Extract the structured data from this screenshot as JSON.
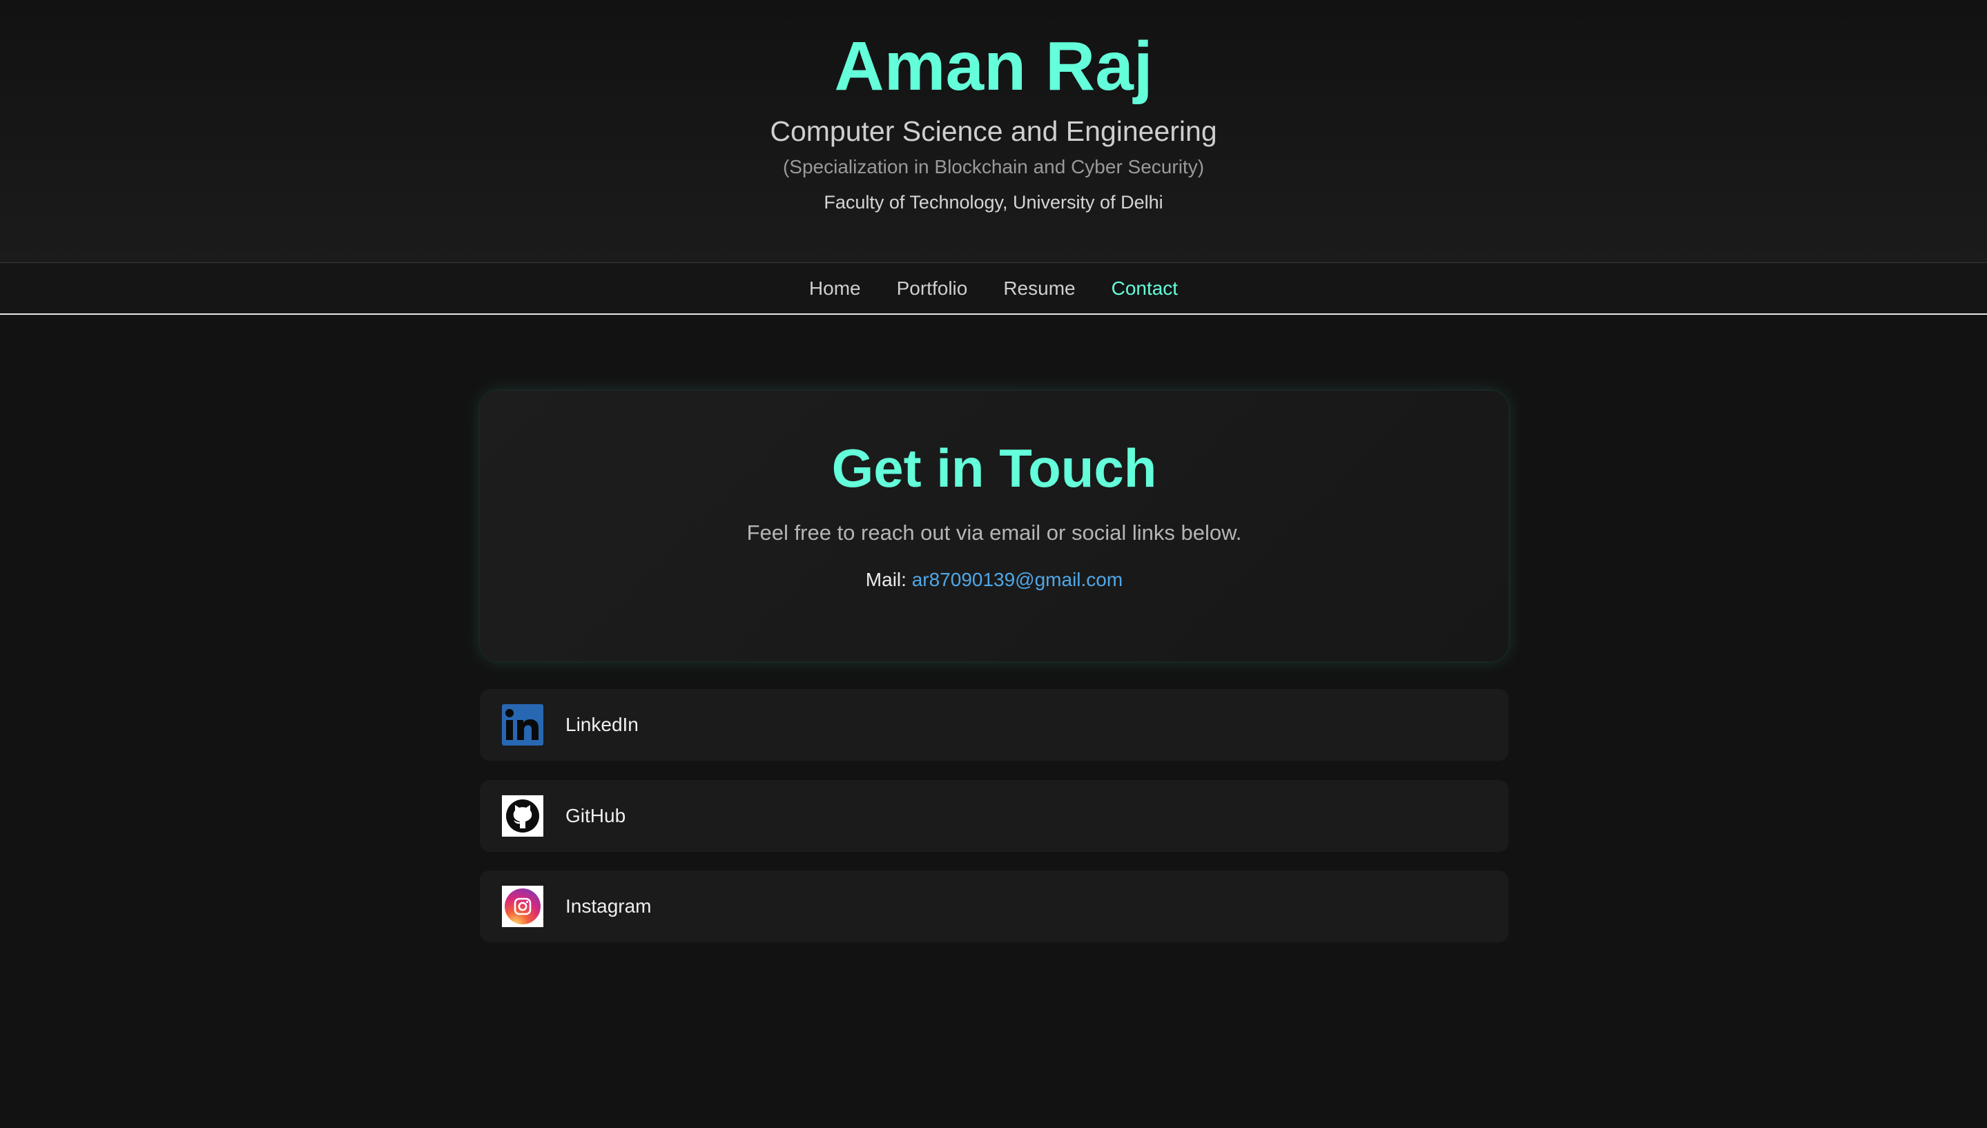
{
  "header": {
    "name": "Aman Raj",
    "subtitle": "Computer Science and Engineering",
    "specialization": "(Specialization in Blockchain and Cyber Security)",
    "faculty": "Faculty of Technology, University of Delhi"
  },
  "nav": {
    "items": [
      {
        "label": "Home",
        "active": false
      },
      {
        "label": "Portfolio",
        "active": false
      },
      {
        "label": "Resume",
        "active": false
      },
      {
        "label": "Contact",
        "active": true
      }
    ]
  },
  "contact": {
    "title": "Get in Touch",
    "description": "Feel free to reach out via email or social links below.",
    "mail_label": "Mail:",
    "mail_address": "ar87090139@gmail.com"
  },
  "social": {
    "items": [
      {
        "label": "LinkedIn",
        "icon": "linkedin-icon"
      },
      {
        "label": "GitHub",
        "icon": "github-icon"
      },
      {
        "label": "Instagram",
        "icon": "instagram-icon"
      }
    ]
  },
  "colors": {
    "accent": "#64ffda",
    "link": "#4fa8e8",
    "background": "#121212",
    "linkedin_blue": "#2867b2"
  }
}
